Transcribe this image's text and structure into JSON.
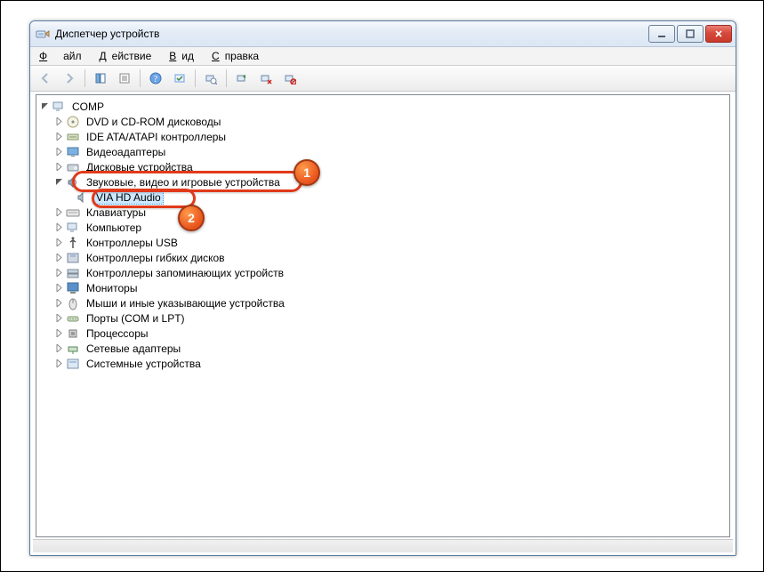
{
  "window": {
    "title": "Диспетчер устройств"
  },
  "menu": {
    "file": "Файл",
    "action": "Действие",
    "view": "Вид",
    "help": "Справка"
  },
  "toolbar_icons": {
    "back": "←",
    "fwd": "→",
    "up": "⇧",
    "props": "☰",
    "help": "?",
    "scan": "⟳",
    "t7": "⚙",
    "t8": "🖥",
    "t9": "🖥",
    "t10": "🖥"
  },
  "tree": {
    "root": "COMP",
    "items": [
      {
        "label": "DVD и CD-ROM дисководы",
        "expanded": false,
        "icon": "disc"
      },
      {
        "label": "IDE ATA/ATAPI контроллеры",
        "expanded": false,
        "icon": "ide"
      },
      {
        "label": "Видеоадаптеры",
        "expanded": false,
        "icon": "display"
      },
      {
        "label": "Дисковые устройства",
        "expanded": false,
        "icon": "hdd"
      },
      {
        "label": "Звуковые, видео и игровые устройства",
        "expanded": true,
        "icon": "sound",
        "children": [
          {
            "label": "VIA HD Audio",
            "icon": "speaker",
            "selected": true
          }
        ]
      },
      {
        "label": "Клавиатуры",
        "expanded": false,
        "icon": "keyboard"
      },
      {
        "label": "Компьютер",
        "expanded": false,
        "icon": "computer"
      },
      {
        "label": "Контроллеры USB",
        "expanded": false,
        "icon": "usb"
      },
      {
        "label": "Контроллеры гибких дисков",
        "expanded": false,
        "icon": "floppyctl"
      },
      {
        "label": "Контроллеры запоминающих устройств",
        "expanded": false,
        "icon": "storagectl"
      },
      {
        "label": "Мониторы",
        "expanded": false,
        "icon": "monitor"
      },
      {
        "label": "Мыши и иные указывающие устройства",
        "expanded": false,
        "icon": "mouse"
      },
      {
        "label": "Порты (COM и LPT)",
        "expanded": false,
        "icon": "ports"
      },
      {
        "label": "Процессоры",
        "expanded": false,
        "icon": "cpu"
      },
      {
        "label": "Сетевые адаптеры",
        "expanded": false,
        "icon": "network"
      },
      {
        "label": "Системные устройства",
        "expanded": false,
        "icon": "system"
      }
    ]
  },
  "annotations": {
    "callout1_num": "1",
    "callout2_num": "2"
  }
}
